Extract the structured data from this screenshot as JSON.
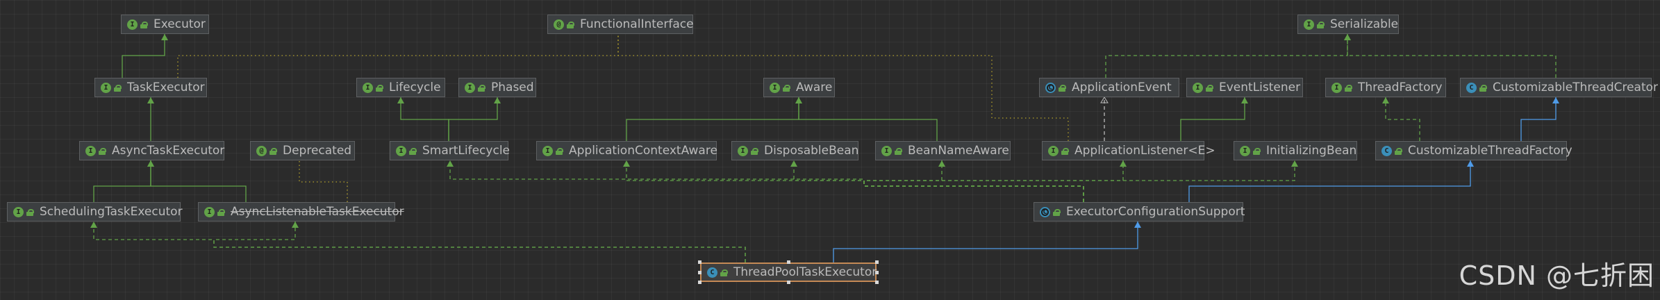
{
  "diagram": {
    "nodes": [
      {
        "id": "Executor",
        "label": "Executor",
        "kind": "interface"
      },
      {
        "id": "FunctionalInterface",
        "label": "FunctionalInterface",
        "kind": "annotation"
      },
      {
        "id": "Serializable",
        "label": "Serializable",
        "kind": "interface"
      },
      {
        "id": "TaskExecutor",
        "label": "TaskExecutor",
        "kind": "interface"
      },
      {
        "id": "Lifecycle",
        "label": "Lifecycle",
        "kind": "interface"
      },
      {
        "id": "Phased",
        "label": "Phased",
        "kind": "interface"
      },
      {
        "id": "Aware",
        "label": "Aware",
        "kind": "interface"
      },
      {
        "id": "ApplicationEvent",
        "label": "ApplicationEvent",
        "kind": "abstract"
      },
      {
        "id": "EventListener",
        "label": "EventListener",
        "kind": "interface"
      },
      {
        "id": "ThreadFactory",
        "label": "ThreadFactory",
        "kind": "interface"
      },
      {
        "id": "CustomizableThreadCreator",
        "label": "CustomizableThreadCreator",
        "kind": "class"
      },
      {
        "id": "AsyncTaskExecutor",
        "label": "AsyncTaskExecutor",
        "kind": "interface"
      },
      {
        "id": "Deprecated",
        "label": "Deprecated",
        "kind": "annotation"
      },
      {
        "id": "SmartLifecycle",
        "label": "SmartLifecycle",
        "kind": "interface"
      },
      {
        "id": "ApplicationContextAware",
        "label": "ApplicationContextAware",
        "kind": "interface"
      },
      {
        "id": "DisposableBean",
        "label": "DisposableBean",
        "kind": "interface"
      },
      {
        "id": "BeanNameAware",
        "label": "BeanNameAware",
        "kind": "interface"
      },
      {
        "id": "ApplicationListener",
        "label": "ApplicationListener<E>",
        "kind": "interface"
      },
      {
        "id": "InitializingBean",
        "label": "InitializingBean",
        "kind": "interface"
      },
      {
        "id": "CustomizableThreadFactory",
        "label": "CustomizableThreadFactory",
        "kind": "class"
      },
      {
        "id": "SchedulingTaskExecutor",
        "label": "SchedulingTaskExecutor",
        "kind": "interface"
      },
      {
        "id": "AsyncListenableTaskExecutor",
        "label": "AsyncListenableTaskExecutor",
        "kind": "interface",
        "deprecated": true
      },
      {
        "id": "ExecutorConfigurationSupport",
        "label": "ExecutorConfigurationSupport",
        "kind": "abstract"
      },
      {
        "id": "ThreadPoolTaskExecutor",
        "label": "ThreadPoolTaskExecutor",
        "kind": "class",
        "selected": true
      }
    ],
    "edges": [
      {
        "from": "TaskExecutor",
        "to": "Executor",
        "type": "extends"
      },
      {
        "from": "AsyncTaskExecutor",
        "to": "TaskExecutor",
        "type": "extends"
      },
      {
        "from": "SchedulingTaskExecutor",
        "to": "AsyncTaskExecutor",
        "type": "extends"
      },
      {
        "from": "AsyncListenableTaskExecutor",
        "to": "AsyncTaskExecutor",
        "type": "extends"
      },
      {
        "from": "SmartLifecycle",
        "to": "Lifecycle",
        "type": "extends"
      },
      {
        "from": "SmartLifecycle",
        "to": "Phased",
        "type": "extends"
      },
      {
        "from": "ApplicationContextAware",
        "to": "Aware",
        "type": "extends"
      },
      {
        "from": "BeanNameAware",
        "to": "Aware",
        "type": "extends"
      },
      {
        "from": "ApplicationListener",
        "to": "EventListener",
        "type": "extends"
      },
      {
        "from": "ApplicationListener",
        "to": "ApplicationEvent",
        "type": "dependency"
      },
      {
        "from": "ApplicationEvent",
        "to": "Serializable",
        "type": "implements"
      },
      {
        "from": "CustomizableThreadCreator",
        "to": "Serializable",
        "type": "implements"
      },
      {
        "from": "CustomizableThreadFactory",
        "to": "ThreadFactory",
        "type": "implements"
      },
      {
        "from": "CustomizableThreadFactory",
        "to": "CustomizableThreadCreator",
        "type": "class-extends"
      },
      {
        "from": "TaskExecutor",
        "to": "FunctionalInterface",
        "type": "annotation"
      },
      {
        "from": "ApplicationListener",
        "to": "FunctionalInterface",
        "type": "annotation"
      },
      {
        "from": "AsyncListenableTaskExecutor",
        "to": "Deprecated",
        "type": "annotation"
      },
      {
        "from": "ExecutorConfigurationSupport",
        "to": "CustomizableThreadFactory",
        "type": "class-extends"
      },
      {
        "from": "ExecutorConfigurationSupport",
        "to": "DisposableBean",
        "type": "implements"
      },
      {
        "from": "ExecutorConfigurationSupport",
        "to": "BeanNameAware",
        "type": "implements"
      },
      {
        "from": "ExecutorConfigurationSupport",
        "to": "InitializingBean",
        "type": "implements"
      },
      {
        "from": "ExecutorConfigurationSupport",
        "to": "ApplicationContextAware",
        "type": "implements"
      },
      {
        "from": "ExecutorConfigurationSupport",
        "to": "ApplicationListener",
        "type": "implements"
      },
      {
        "from": "ExecutorConfigurationSupport",
        "to": "SmartLifecycle",
        "type": "implements"
      },
      {
        "from": "ThreadPoolTaskExecutor",
        "to": "ExecutorConfigurationSupport",
        "type": "class-extends"
      },
      {
        "from": "ThreadPoolTaskExecutor",
        "to": "SchedulingTaskExecutor",
        "type": "implements"
      },
      {
        "from": "ThreadPoolTaskExecutor",
        "to": "AsyncListenableTaskExecutor",
        "type": "implements"
      }
    ],
    "colors": {
      "extends": "#62a348",
      "implements": "#62a348",
      "class-extends": "#4f9be8",
      "annotation": "#b5a22b",
      "dependency": "#bbbbbb"
    }
  },
  "watermark": "CSDN @七折困"
}
